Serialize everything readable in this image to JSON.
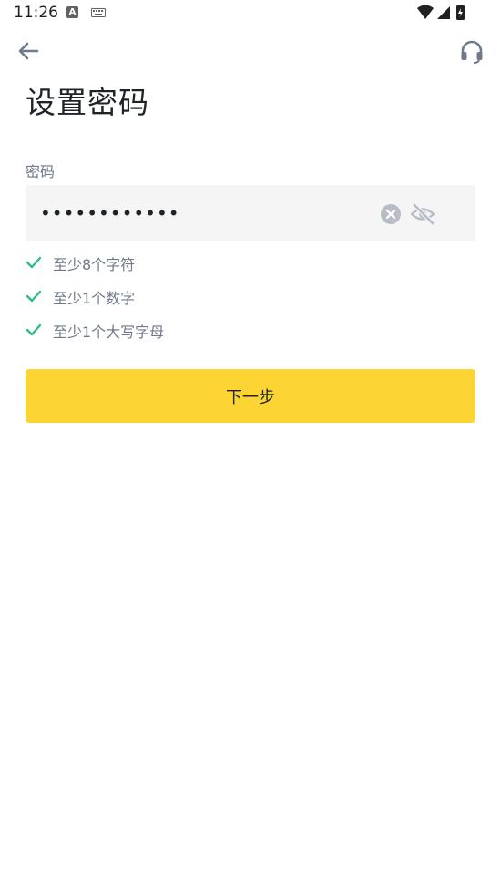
{
  "status_bar": {
    "time": "11:26",
    "icons": [
      "a-notification-icon",
      "keyboard-icon",
      "wifi-icon",
      "signal-icon",
      "battery-icon"
    ]
  },
  "header": {
    "back_icon": "arrow-left-icon",
    "support_icon": "headset-icon"
  },
  "title": "设置密码",
  "password": {
    "label": "密码",
    "value": "••••••••••••",
    "clear_icon": "clear-circle-icon",
    "visibility_icon": "eye-off-icon"
  },
  "rules": [
    {
      "text": "至少8个字符",
      "met": true
    },
    {
      "text": "至少1个数字",
      "met": true
    },
    {
      "text": "至少1个大写字母",
      "met": true
    }
  ],
  "next_button": {
    "label": "下一步"
  },
  "colors": {
    "primary": "#fcd535",
    "check": "#2ebd85",
    "muted_text": "#707a8a",
    "input_bg": "#f5f5f5",
    "title_text": "#1e2329"
  }
}
